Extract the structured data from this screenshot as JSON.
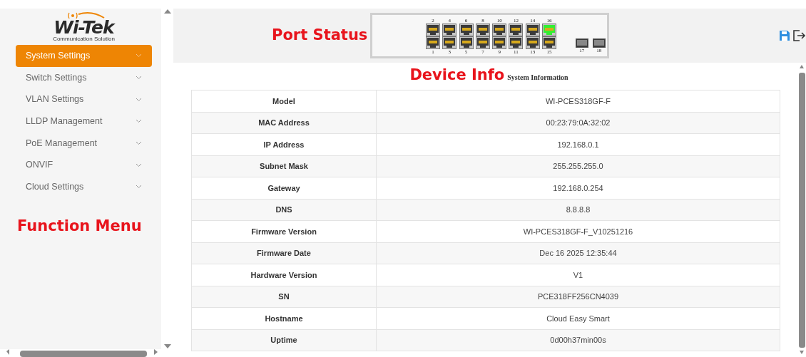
{
  "logo": {
    "name": "Wi-Tek",
    "tagline": "Communication Solution"
  },
  "sidebar": {
    "items": [
      {
        "label": "System Settings",
        "selected": true
      },
      {
        "label": "Switch Settings",
        "selected": false
      },
      {
        "label": "VLAN Settings",
        "selected": false
      },
      {
        "label": "LLDP Management",
        "selected": false
      },
      {
        "label": "PoE Management",
        "selected": false
      },
      {
        "label": "ONVIF",
        "selected": false
      },
      {
        "label": "Cloud Settings",
        "selected": false
      }
    ],
    "annotation": "Function Menu"
  },
  "header": {
    "annotation": "Port Status",
    "ports": [
      {
        "label": "2",
        "kind": "rj45",
        "link": false
      },
      {
        "label": "4",
        "kind": "rj45",
        "link": false
      },
      {
        "label": "6",
        "kind": "rj45",
        "link": false
      },
      {
        "label": "8",
        "kind": "rj45",
        "link": false
      },
      {
        "label": "10",
        "kind": "rj45",
        "link": false
      },
      {
        "label": "12",
        "kind": "rj45",
        "link": false
      },
      {
        "label": "14",
        "kind": "rj45",
        "link": false
      },
      {
        "label": "16",
        "kind": "rj45",
        "link": true
      },
      {
        "label": "1",
        "kind": "rj45",
        "link": false
      },
      {
        "label": "3",
        "kind": "rj45",
        "link": false
      },
      {
        "label": "5",
        "kind": "rj45",
        "link": false
      },
      {
        "label": "7",
        "kind": "rj45",
        "link": false
      },
      {
        "label": "9",
        "kind": "rj45",
        "link": false
      },
      {
        "label": "11",
        "kind": "rj45",
        "link": false
      },
      {
        "label": "13",
        "kind": "rj45",
        "link": false
      },
      {
        "label": "15",
        "kind": "rj45",
        "link": false
      },
      {
        "label": "17",
        "kind": "sfp",
        "link": false
      },
      {
        "label": "18",
        "kind": "sfp",
        "link": false
      }
    ]
  },
  "content": {
    "annotation": "Device Info",
    "title": "System Information",
    "rows": [
      {
        "label": "Model",
        "value": "WI-PCES318GF-F"
      },
      {
        "label": "MAC Address",
        "value": "00:23:79:0A:32:02"
      },
      {
        "label": "IP Address",
        "value": "192.168.0.1"
      },
      {
        "label": "Subnet Mask",
        "value": "255.255.255.0"
      },
      {
        "label": "Gateway",
        "value": "192.168.0.254"
      },
      {
        "label": "DNS",
        "value": "8.8.8.8"
      },
      {
        "label": "Firmware Version",
        "value": "WI-PCES318GF-F_V10251216"
      },
      {
        "label": "Firmware Date",
        "value": "Dec 16 2025 12:35:44"
      },
      {
        "label": "Hardware Version",
        "value": "V1"
      },
      {
        "label": "SN",
        "value": "PCE318FF256CN4039"
      },
      {
        "label": "Hostname",
        "value": "Cloud Easy Smart"
      },
      {
        "label": "Uptime",
        "value": "0d00h37min00s"
      }
    ]
  }
}
